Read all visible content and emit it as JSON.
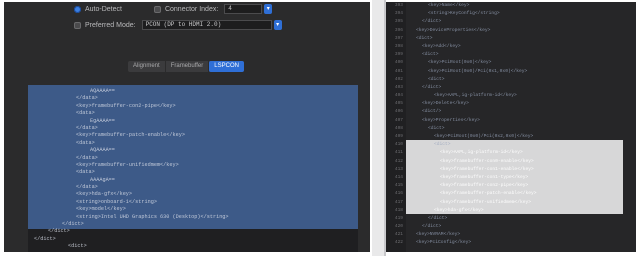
{
  "options": {
    "auto_detect": "Auto-Detect",
    "connector_index_label": "Connector Index:",
    "connector_index_value": "4",
    "preferred_mode_label": "Preferred Mode:",
    "preferred_mode_value": "PCON (DP to HDMI 2.0)"
  },
  "tabs": [
    "Alignment",
    "Framebuffer",
    "LSPCON"
  ],
  "active_tab": "LSPCON",
  "left_code": [
    "AQAAAA==",
    "</data>",
    "<key>framebuffer-con2-pipe</key>",
    "<data>",
    "EgAAAA==",
    "</data>",
    "<key>framebuffer-patch-enable</key>",
    "<data>",
    "AQAAAA==",
    "</data>",
    "<key>framebuffer-unifiedmem</key>",
    "<data>",
    "AAAAgA==",
    "</data>",
    "<key>hda-gfx</key>",
    "<string>onboard-1</string>",
    "<key>model</key>",
    "<string>Intel UHD Graphics 630 (Desktop)</string>",
    "</dict>",
    "</dict>",
    "</dict>",
    "<dict>"
  ],
  "right_line_numbers": [
    "393",
    "394",
    "395",
    "396",
    "397",
    "398",
    "399",
    "400",
    "401",
    "402",
    "403",
    "404",
    "405",
    "406",
    "407",
    "408",
    "409",
    "410",
    "411",
    "412",
    "413",
    "414",
    "415",
    "416",
    "417",
    "418",
    "419",
    "420",
    "421",
    "422"
  ],
  "right_code": [
    "<key>Name</key>",
    "<string>KeyConfig</string>",
    "</dict>",
    "<key>DeviceProperties</key>",
    "<dict>",
    "<key>Add</key>",
    "<dict>",
    "<key>PciRoot(0x0)</key>",
    "<key>PciRoot(0x0)/Pci(0x1,0x0)</key>",
    "<dict>",
    "</dict>",
    "<key>AAPL,ig-platform-id</key>",
    "<key>Delete</key>",
    "<dict/>",
    "<key>Properties</key>",
    "<dict>",
    "<key>PciRoot(0x0)/Pci(0x2,0x0)</key>",
    "<dict>",
    "<key>AAPL,ig-platform-id</key>",
    "<key>framebuffer-con0-enable</key>",
    "<key>framebuffer-con1-enable</key>",
    "<key>framebuffer-con1-type</key>",
    "<key>framebuffer-con2-pipe</key>",
    "<key>framebuffer-patch-enable</key>",
    "<key>framebuffer-unifiedmem</key>",
    "<key>hda-gfx</key>",
    "</dict>",
    "</dict>",
    "<key>NVRAM</key>",
    "<key>PciConfig</key>"
  ],
  "right_selected_rows": [
    18,
    19,
    20,
    21,
    22,
    23,
    24,
    25
  ]
}
